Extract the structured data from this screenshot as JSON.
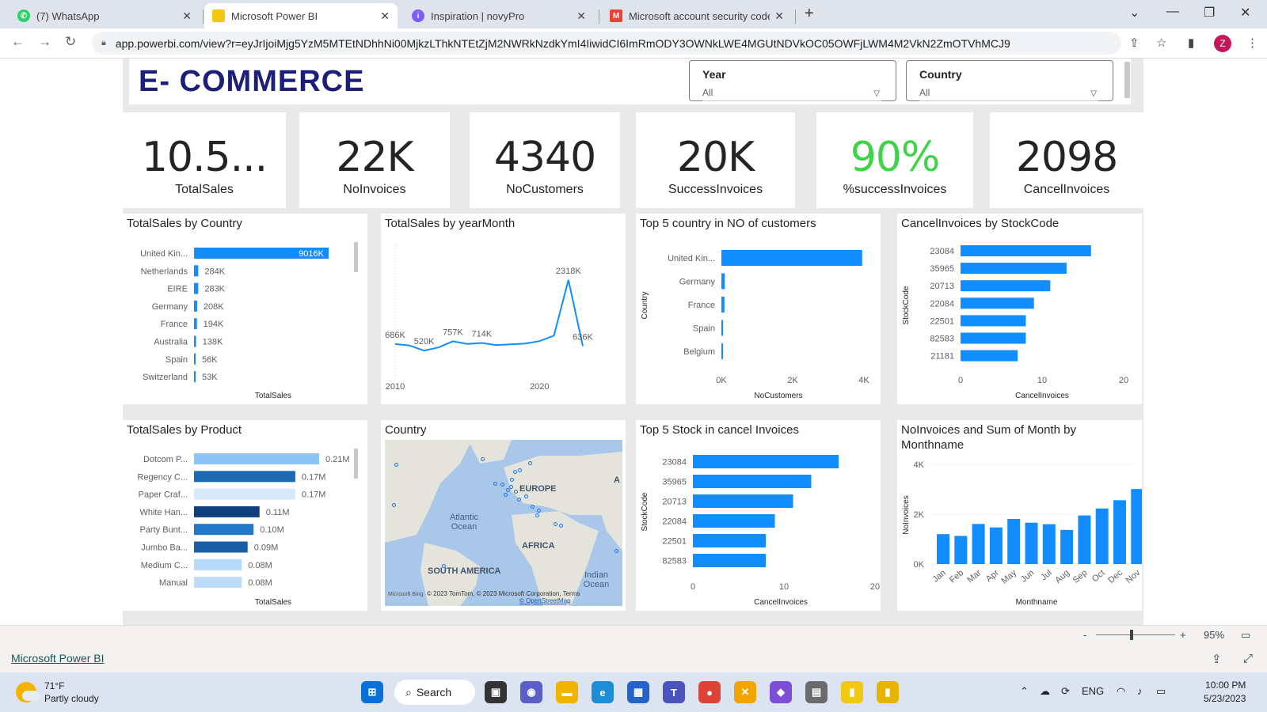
{
  "browser": {
    "tabs": [
      {
        "title": "(7) WhatsApp",
        "icon": "whatsapp-icon",
        "color": "#25d366",
        "active": false
      },
      {
        "title": "Microsoft Power BI",
        "icon": "powerbi-icon",
        "color": "#f2c811",
        "active": true
      },
      {
        "title": "Inspiration | novyPro",
        "icon": "novypro-icon",
        "color": "#7b5cff",
        "active": false
      },
      {
        "title": "Microsoft account security code",
        "icon": "gmail-icon",
        "color": "#ea4335",
        "active": false
      }
    ],
    "url": "app.powerbi.com/view?r=eyJrIjoiMjg5YzM5MTEtNDhhNi00MjkzLThkNTEtZjM2NWRkNzdkYmI4IiwidCI6ImRmODY3OWNkLWE4MGUtNDVkOC05OWFjLWM4M2VkN2ZmOTVhMCJ9",
    "profile_initial": "Z"
  },
  "report": {
    "title": "E- COMMERCE",
    "slicers": [
      {
        "label": "Year",
        "value": "All"
      },
      {
        "label": "Country",
        "value": "All"
      }
    ],
    "kpis": [
      {
        "value": "10.5...",
        "label": "TotalSales",
        "color": "#252423"
      },
      {
        "value": "22K",
        "label": "NoInvoices",
        "color": "#252423"
      },
      {
        "value": "4340",
        "label": "NoCustomers",
        "color": "#252423"
      },
      {
        "value": "20K",
        "label": "SuccessInvoices",
        "color": "#252423"
      },
      {
        "value": "90%",
        "label": "%successInvoices",
        "color": "#3fd34a"
      },
      {
        "value": "2098",
        "label": "CancelInvoices",
        "color": "#252423"
      }
    ],
    "map": {
      "title": "Country",
      "labels": {
        "europe": "EUROPE",
        "atlantic": "Atlantic Ocean",
        "africa": "AFRICA",
        "south_america": "SOUTH AMERICA",
        "indian": "Indian Ocean",
        "a": "A"
      },
      "footer": "© 2023 TomTom, © 2023 Microsoft Corporation, Terms",
      "link": "© OpenStreetMap",
      "bing": "Microsoft Bing"
    }
  },
  "chart_data": [
    {
      "type": "bar",
      "title": "TotalSales by Country",
      "xlabel": "TotalSales",
      "categories": [
        "United Kin...",
        "Netherlands",
        "EIRE",
        "Germany",
        "France",
        "Australia",
        "Spain",
        "Switzerland"
      ],
      "values": [
        9016,
        284,
        283,
        208,
        194,
        138,
        56,
        53
      ],
      "labels": [
        "9016K",
        "284K",
        "283K",
        "208K",
        "194K",
        "138K",
        "56K",
        "53K"
      ]
    },
    {
      "type": "line",
      "title": "TotalSales by yearMonth",
      "x": [
        2010,
        2011,
        2012,
        2013,
        2014,
        2015,
        2016,
        2017,
        2018,
        2019,
        2020,
        2021,
        2022,
        2023
      ],
      "values": [
        686,
        650,
        520,
        600,
        757,
        690,
        714,
        660,
        680,
        700,
        760,
        900,
        2318,
        636
      ],
      "point_labels": [
        {
          "i": 0,
          "text": "686K"
        },
        {
          "i": 2,
          "text": "520K"
        },
        {
          "i": 4,
          "text": "757K"
        },
        {
          "i": 6,
          "text": "714K"
        },
        {
          "i": 12,
          "text": "2318K"
        },
        {
          "i": 13,
          "text": "636K"
        }
      ],
      "xticks": [
        "2010",
        "2020"
      ]
    },
    {
      "type": "bar",
      "title": "Top 5 country in NO of customers",
      "xlabel": "NoCustomers",
      "ylabel": "Country",
      "categories": [
        "United Kin...",
        "Germany",
        "France",
        "Spain",
        "Belgium"
      ],
      "values": [
        3950,
        95,
        87,
        31,
        25
      ],
      "xlim": [
        0,
        4000
      ],
      "xticks": [
        "0K",
        "2K",
        "4K"
      ]
    },
    {
      "type": "bar",
      "title": "CancelInvoices by StockCode",
      "xlabel": "CancelInvoices",
      "ylabel": "StockCode",
      "categories": [
        "23084",
        "35965",
        "20713",
        "22084",
        "22501",
        "82583",
        "21181"
      ],
      "values": [
        16,
        13,
        11,
        9,
        8,
        8,
        7
      ],
      "xlim": [
        0,
        20
      ],
      "xticks": [
        "0",
        "10",
        "20"
      ]
    },
    {
      "type": "bar",
      "title": "TotalSales by Product",
      "xlabel": "TotalSales",
      "categories": [
        "Dotcom P...",
        "Regency C...",
        "Paper Craf...",
        "White Han...",
        "Party Bunt...",
        "Jumbo Ba...",
        "Medium C...",
        "Manual"
      ],
      "values": [
        0.21,
        0.17,
        0.17,
        0.11,
        0.1,
        0.09,
        0.08,
        0.08
      ],
      "labels": [
        "0.21M",
        "0.17M",
        "0.17M",
        "0.11M",
        "0.10M",
        "0.09M",
        "0.08M",
        "0.08M"
      ],
      "colors": [
        "#8dc3f5",
        "#1d69b4",
        "#d6e9fb",
        "#103f7d",
        "#2377c8",
        "#1a5fa6",
        "#b7daf8",
        "#bcdcf9"
      ]
    },
    {
      "type": "bar",
      "title": "Top 5 Stock in cancel Invoices",
      "xlabel": "CancelInvoices",
      "ylabel": "StockCode",
      "categories": [
        "23084",
        "35965",
        "20713",
        "22084",
        "22501",
        "82583"
      ],
      "values": [
        16,
        13,
        11,
        9,
        8,
        8
      ],
      "xlim": [
        0,
        20
      ],
      "xticks": [
        "0",
        "10",
        "20"
      ]
    },
    {
      "type": "bar",
      "title": "NoInvoices and Sum of Month by Monthname",
      "xlabel": "Monthname",
      "ylabel": "NoInvoices",
      "categories": [
        "Jan",
        "Feb",
        "Mar",
        "Apr",
        "May",
        "Jun",
        "Jul",
        "Aug",
        "Sep",
        "Oct",
        "Dec",
        "Nov"
      ],
      "values": [
        1200,
        1130,
        1610,
        1470,
        1810,
        1660,
        1600,
        1370,
        1950,
        2230,
        2560,
        3010
      ],
      "ylim": [
        0,
        4000
      ],
      "yticks": [
        "0K",
        "2K",
        "4K"
      ]
    }
  ],
  "footer": {
    "zoom": "95%",
    "app_link": "Microsoft Power BI"
  },
  "taskbar": {
    "temp": "71°F",
    "weather": "Partly cloudy",
    "search": "Search",
    "lang": "ENG",
    "time": "10:00 PM",
    "date": "5/23/2023"
  }
}
